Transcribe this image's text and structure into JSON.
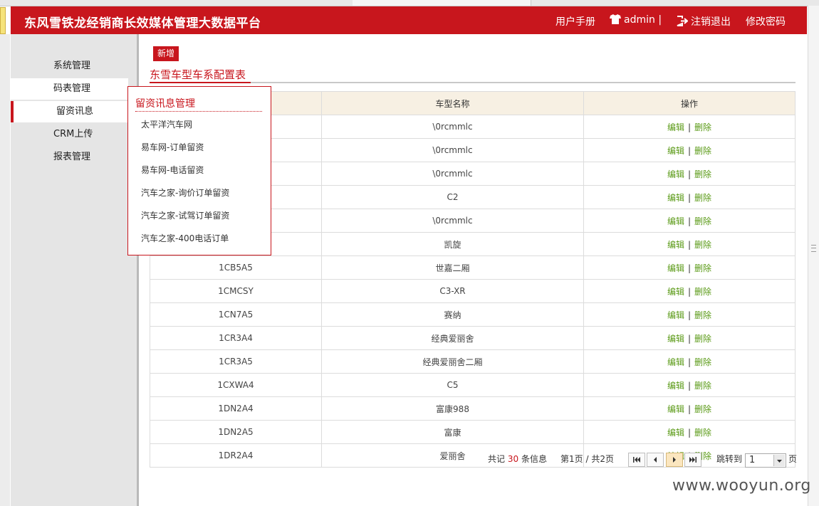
{
  "app": {
    "title": "东风雪铁龙经销商长效媒体管理大数据平台",
    "nav": {
      "manual": "用户手册",
      "user": "admin |",
      "logout": "注销退出",
      "change_password": "修改密码"
    }
  },
  "sidebar": {
    "items": [
      {
        "label": "系统管理"
      },
      {
        "label": "码表管理"
      },
      {
        "label": "留资讯息"
      },
      {
        "label": "CRM上传"
      },
      {
        "label": "报表管理"
      }
    ]
  },
  "popup": {
    "title": "留资讯息管理",
    "items": [
      {
        "label": "太平洋汽车网"
      },
      {
        "label": "易车网-订单留资"
      },
      {
        "label": "易车网-电话留资"
      },
      {
        "label": "汽车之家-询价订单留资"
      },
      {
        "label": "汽车之家-试驾订单留资"
      },
      {
        "label": "汽车之家-400电话订单"
      }
    ]
  },
  "main": {
    "add_button": "新增",
    "page_title": "东雪车型车系配置表",
    "table": {
      "columns": [
        "",
        "车型名称",
        "操作"
      ],
      "edit_label": "编辑",
      "delete_label": "删除",
      "separator": "|",
      "rows": [
        {
          "code": "",
          "name": "\\0rcmmlc"
        },
        {
          "code": "",
          "name": "\\0rcmmlc"
        },
        {
          "code": "",
          "name": "\\0rcmmlc"
        },
        {
          "code": "",
          "name": "C2"
        },
        {
          "code": "",
          "name": "\\0rcmmlc"
        },
        {
          "code": "",
          "name": "凯旋"
        },
        {
          "code": "1CB5A5",
          "name": "世嘉二厢"
        },
        {
          "code": "1CMCSY",
          "name": "C3-XR"
        },
        {
          "code": "1CN7A5",
          "name": "赛纳"
        },
        {
          "code": "1CR3A4",
          "name": "经典爱丽舍"
        },
        {
          "code": "1CR3A5",
          "name": "经典爱丽舍二厢"
        },
        {
          "code": "1CXWA4",
          "name": "C5"
        },
        {
          "code": "1DN2A4",
          "name": "富康988"
        },
        {
          "code": "1DN2A5",
          "name": "富康"
        },
        {
          "code": "1DR2A4",
          "name": "爱丽舍"
        }
      ]
    },
    "pager": {
      "total_prefix": "共记",
      "total": "30",
      "total_suffix": "条信息",
      "page_prefix": "第",
      "current": "1",
      "page_mid": "页 / 共",
      "pages": "2",
      "page_suffix": "页",
      "jump_label": "跳转到",
      "jump_value": "1",
      "jump_suffix": "页"
    }
  },
  "watermark": "www.wooyun.org"
}
